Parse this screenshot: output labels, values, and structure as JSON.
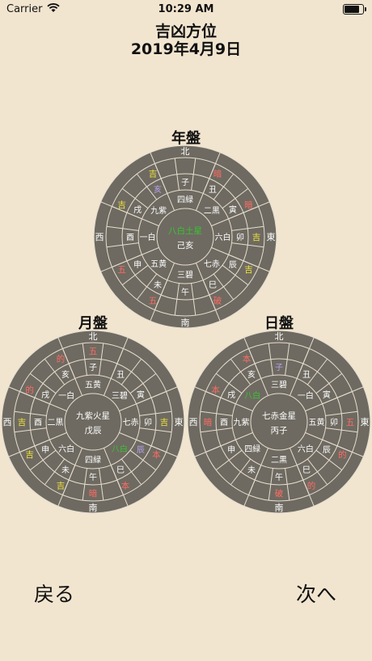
{
  "status": {
    "carrier": "Carrier",
    "time": "10:29 AM",
    "battery_level": 0.9
  },
  "header": {
    "title": "吉凶方位",
    "date": "2019年4月9日"
  },
  "nav": {
    "back": "戻る",
    "next": "次へ"
  },
  "colors": {
    "background": "#f2e5cf",
    "board": "#6e6a61",
    "line": "#e6dfd0",
    "text": "#ffffff",
    "kichi": "#f0e33a",
    "bad": "#ff6b63",
    "mauve": "#b7a2f0",
    "green": "#38c431"
  },
  "panels": [
    {
      "title": "年盤",
      "center_star": "八白土星",
      "center_star_color": "green",
      "center_kanshi": "己亥",
      "stars": [
        "四緑",
        "二黒",
        "六白",
        "七赤",
        "三碧",
        "五黄",
        "一白",
        "九紫"
      ],
      "star_colors": [
        "white",
        "white",
        "white",
        "white",
        "white",
        "white",
        "white",
        "white"
      ],
      "outer_labels": [
        [
          "",
          ""
        ],
        [
          "暗",
          "白"
        ],
        [
          "破",
          ""
        ],
        [
          "吉",
          ""
        ],
        [
          "",
          ""
        ],
        [
          "",
          "暗"
        ],
        [
          "",
          ""
        ],
        [
          "",
          ""
        ]
      ],
      "outer_colors": [
        [
          "white",
          "white"
        ],
        [
          "red",
          "white"
        ],
        [
          "red",
          "white"
        ],
        [
          "yellow",
          "white"
        ],
        [
          "white",
          "white"
        ],
        [
          "white",
          "red"
        ],
        [
          "white",
          "white"
        ],
        [
          "white",
          "white"
        ]
      ],
      "outer_all": [
        {
          "t": "",
          "c": "white"
        },
        {
          "t": "暗",
          "c": "red"
        },
        {
          "t": "暗",
          "c": "red"
        },
        {
          "t": "吉",
          "c": "yellow"
        },
        {
          "t": "吉",
          "c": "yellow"
        },
        {
          "t": "破",
          "c": "red"
        },
        {
          "t": "",
          "c": "white"
        },
        {
          "t": "五",
          "c": "red"
        },
        {
          "t": "五",
          "c": "red"
        },
        {
          "t": "",
          "c": "white"
        },
        {
          "t": "吉",
          "c": "yellow"
        },
        {
          "t": "吉",
          "c": "yellow"
        }
      ],
      "zodiac": [
        {
          "t": "子",
          "c": "white"
        },
        {
          "t": "丑",
          "c": "white"
        },
        {
          "t": "寅",
          "c": "white"
        },
        {
          "t": "卯",
          "c": "white"
        },
        {
          "t": "辰",
          "c": "white"
        },
        {
          "t": "巳",
          "c": "white"
        },
        {
          "t": "午",
          "c": "white"
        },
        {
          "t": "未",
          "c": "white"
        },
        {
          "t": "申",
          "c": "white"
        },
        {
          "t": "酉",
          "c": "white"
        },
        {
          "t": "戌",
          "c": "white"
        },
        {
          "t": "亥",
          "c": "mauve"
        }
      ],
      "zodiac_override": {
        "11": "亥"
      },
      "compass": [
        "北",
        "東",
        "南",
        "西"
      ]
    },
    {
      "title": "月盤",
      "center_star": "九紫火星",
      "center_star_color": "white",
      "center_kanshi": "戊辰",
      "stars": [
        "五黄",
        "三碧",
        "七赤",
        "八白",
        "四緑",
        "六白",
        "二黒",
        "一白"
      ],
      "star_colors": [
        "white",
        "white",
        "white",
        "green",
        "white",
        "white",
        "white",
        "white"
      ],
      "outer_all": [
        {
          "t": "五",
          "c": "red"
        },
        {
          "t": "",
          "c": "white"
        },
        {
          "t": "",
          "c": "white"
        },
        {
          "t": "吉",
          "c": "yellow"
        },
        {
          "t": "本",
          "c": "red"
        },
        {
          "t": "本",
          "c": "red"
        },
        {
          "t": "暗",
          "c": "red"
        },
        {
          "t": "吉",
          "c": "yellow"
        },
        {
          "t": "吉",
          "c": "yellow"
        },
        {
          "t": "吉",
          "c": "yellow"
        },
        {
          "t": "的",
          "c": "red"
        },
        {
          "t": "的",
          "c": "red"
        }
      ],
      "zodiac": [
        {
          "t": "子",
          "c": "white"
        },
        {
          "t": "丑",
          "c": "white"
        },
        {
          "t": "寅",
          "c": "white"
        },
        {
          "t": "卯",
          "c": "white"
        },
        {
          "t": "辰",
          "c": "mauve"
        },
        {
          "t": "巳",
          "c": "white"
        },
        {
          "t": "午",
          "c": "white"
        },
        {
          "t": "未",
          "c": "white"
        },
        {
          "t": "申",
          "c": "white"
        },
        {
          "t": "酉",
          "c": "white"
        },
        {
          "t": "戌",
          "c": "white"
        },
        {
          "t": "亥",
          "c": "white"
        }
      ],
      "compass": [
        "北",
        "東",
        "南",
        "西"
      ]
    },
    {
      "title": "日盤",
      "center_star": "七赤金星",
      "center_star_color": "white",
      "center_kanshi": "丙子",
      "stars": [
        "三碧",
        "一白",
        "五黄",
        "六白",
        "二黒",
        "四緑",
        "九紫",
        "八白"
      ],
      "star_colors": [
        "white",
        "white",
        "white",
        "white",
        "white",
        "white",
        "white",
        "green"
      ],
      "outer_all": [
        {
          "t": "",
          "c": "white"
        },
        {
          "t": "",
          "c": "white"
        },
        {
          "t": "",
          "c": "white"
        },
        {
          "t": "五",
          "c": "red"
        },
        {
          "t": "的",
          "c": "red"
        },
        {
          "t": "的",
          "c": "red"
        },
        {
          "t": "破",
          "c": "red"
        },
        {
          "t": "",
          "c": "white"
        },
        {
          "t": "",
          "c": "white"
        },
        {
          "t": "暗",
          "c": "red"
        },
        {
          "t": "本",
          "c": "red"
        },
        {
          "t": "本",
          "c": "red"
        }
      ],
      "zodiac": [
        {
          "t": "子",
          "c": "mauve"
        },
        {
          "t": "丑",
          "c": "white"
        },
        {
          "t": "寅",
          "c": "white"
        },
        {
          "t": "卯",
          "c": "white"
        },
        {
          "t": "辰",
          "c": "white"
        },
        {
          "t": "巳",
          "c": "white"
        },
        {
          "t": "午",
          "c": "white"
        },
        {
          "t": "未",
          "c": "white"
        },
        {
          "t": "申",
          "c": "white"
        },
        {
          "t": "酉",
          "c": "white"
        },
        {
          "t": "戌",
          "c": "white"
        },
        {
          "t": "亥",
          "c": "white"
        }
      ],
      "compass": [
        "北",
        "東",
        "南",
        "西"
      ]
    }
  ]
}
